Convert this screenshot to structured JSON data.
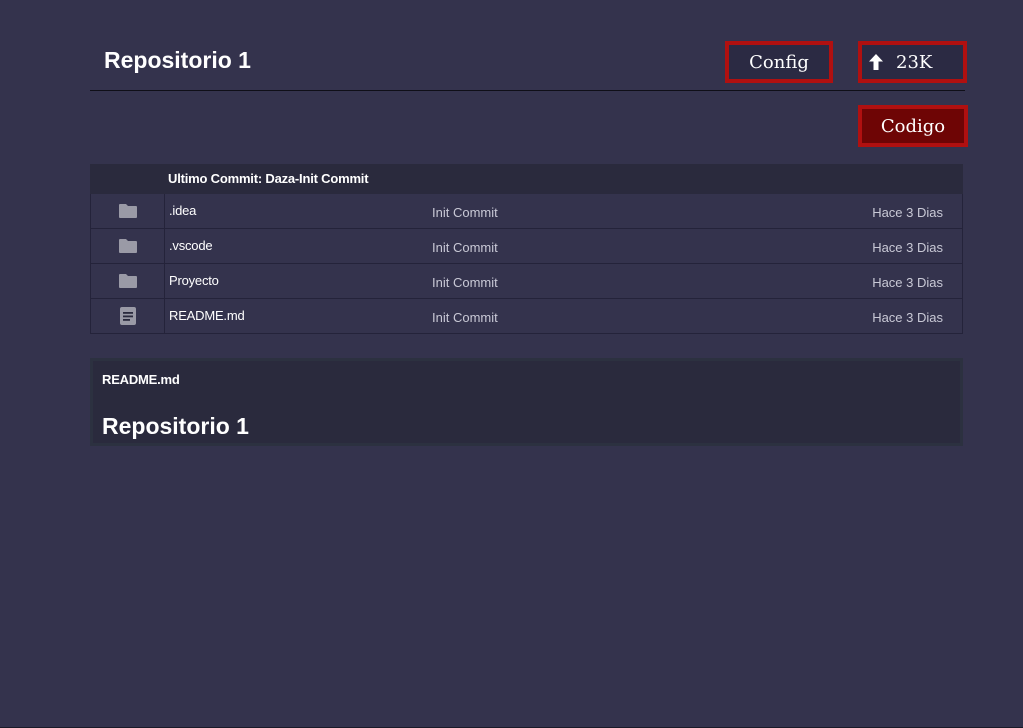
{
  "header": {
    "title": "Repositorio 1",
    "config_label": "Config",
    "stars_label": "23K",
    "codigo_label": "Codigo"
  },
  "files": {
    "last_commit": "Ultimo Commit: Daza-Init Commit",
    "rows": [
      {
        "icon": "folder-icon",
        "name": ".idea",
        "commit": "Init Commit",
        "date": "Hace 3 Dias"
      },
      {
        "icon": "folder-icon",
        "name": ".vscode",
        "commit": "Init Commit",
        "date": "Hace 3 Dias"
      },
      {
        "icon": "folder-icon",
        "name": "Proyecto",
        "commit": "Init Commit",
        "date": "Hace 3 Dias"
      },
      {
        "icon": "file-icon",
        "name": "README.md",
        "commit": "Init Commit",
        "date": "Hace 3 Dias"
      }
    ]
  },
  "readme": {
    "label": "README.md",
    "heading": "Repositorio 1"
  },
  "colors": {
    "background": "#34334d",
    "button_border": "#b01010",
    "codigo_bg": "#6e0505",
    "table_head_bg": "#2a2a3d",
    "icon_gray": "#9a9aa6"
  }
}
